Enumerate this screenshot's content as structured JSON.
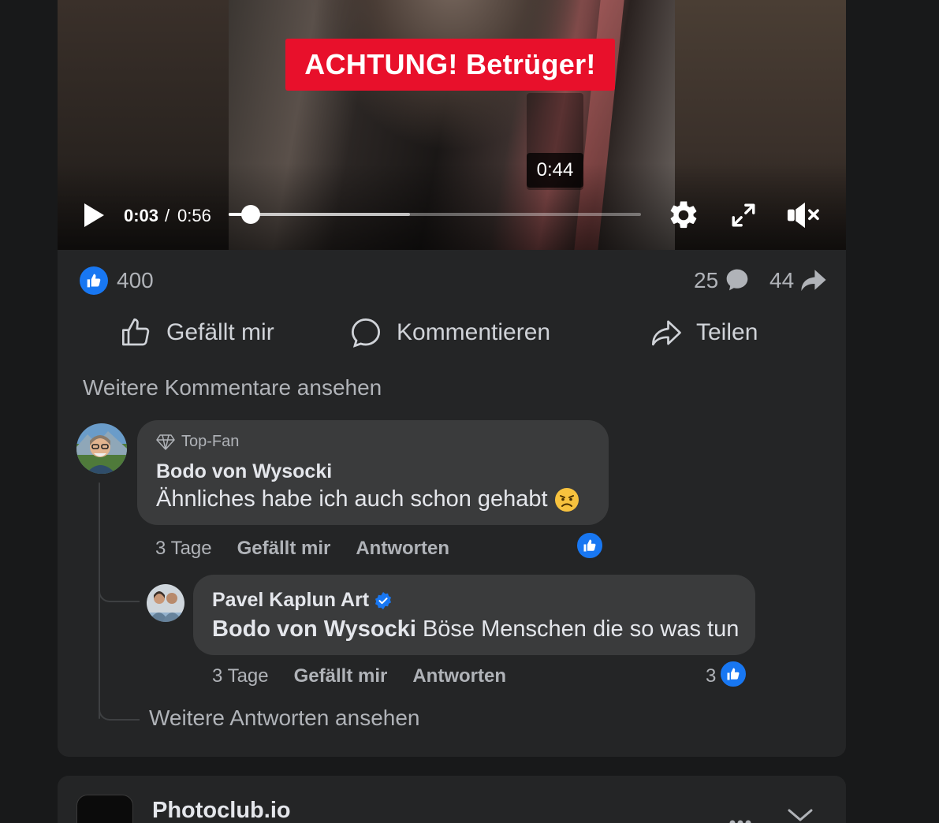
{
  "video": {
    "overlay_text": "ACHTUNG! Betrüger!",
    "preview_time": "0:44",
    "current_time": "0:03",
    "separator": "/",
    "duration": "0:56",
    "played_fraction": 0.054,
    "buffered_fraction": 0.44
  },
  "stats": {
    "reactions": "400",
    "comments": "25",
    "shares": "44"
  },
  "actions": {
    "like": "Gefällt mir",
    "comment": "Kommentieren",
    "share": "Teilen"
  },
  "more_comments": "Weitere Kommentare ansehen",
  "comment": {
    "badge": "Top-Fan",
    "author": "Bodo von Wysocki",
    "text": "Ähnliches habe ich auch schon gehabt",
    "time": "3 Tage",
    "like": "Gefällt mir",
    "reply": "Antworten"
  },
  "reply": {
    "author": "Pavel Kaplun Art",
    "mention": "Bodo von Wysocki",
    "text": " Böse Menschen die so was tun",
    "time": "3 Tage",
    "like": "Gefällt mir",
    "reply": "Antworten",
    "reaction_count": "3"
  },
  "more_replies": "Weitere Antworten ansehen",
  "next_post": {
    "title": "Photoclub.io"
  },
  "colors": {
    "page_bg": "#18191a",
    "card_bg": "#242526",
    "bubble_bg": "#3a3b3c",
    "accent_blue": "#1877f2",
    "banner_red": "#e8102b"
  },
  "icons": [
    "play-icon",
    "gear-icon",
    "fullscreen-icon",
    "muted-volume-icon",
    "thumbs-up-icon",
    "comment-icon",
    "share-icon",
    "diamond-icon",
    "verified-badge-icon",
    "angry-emoji-icon",
    "more-icon",
    "chevron-down-icon"
  ]
}
